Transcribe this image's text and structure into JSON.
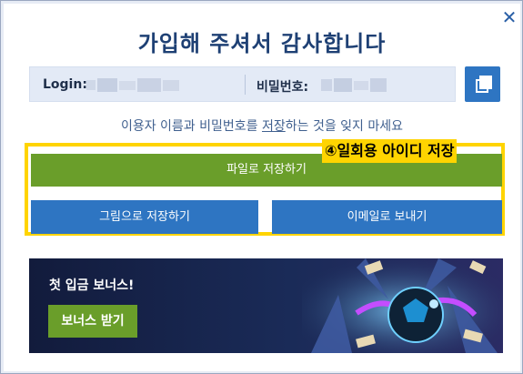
{
  "dialog": {
    "title": "가입해 주셔서 감사합니다",
    "close_glyph": "✕"
  },
  "credentials": {
    "login_label": "Login:",
    "password_label": "비밀번호:"
  },
  "notice": {
    "before": "이용자 이름과 비밀번호를 ",
    "link": "저장",
    "after": "하는 것을 잊지 마세요"
  },
  "buttons": {
    "save_file": "파일로 저장하기",
    "save_image": "그림으로 저장하기",
    "send_email": "이메일로 보내기"
  },
  "callout": {
    "text": "④일회용 아이디 저장"
  },
  "banner": {
    "title": "첫 입금 보너스!",
    "cta": "보너스 받기"
  },
  "icons": {
    "close": "close-icon",
    "copy": "copy-icon"
  },
  "colors": {
    "primary_blue": "#2e75c2",
    "accent_green": "#6a9e2a",
    "highlight_yellow": "#ffd400",
    "title_navy": "#1e4074"
  }
}
